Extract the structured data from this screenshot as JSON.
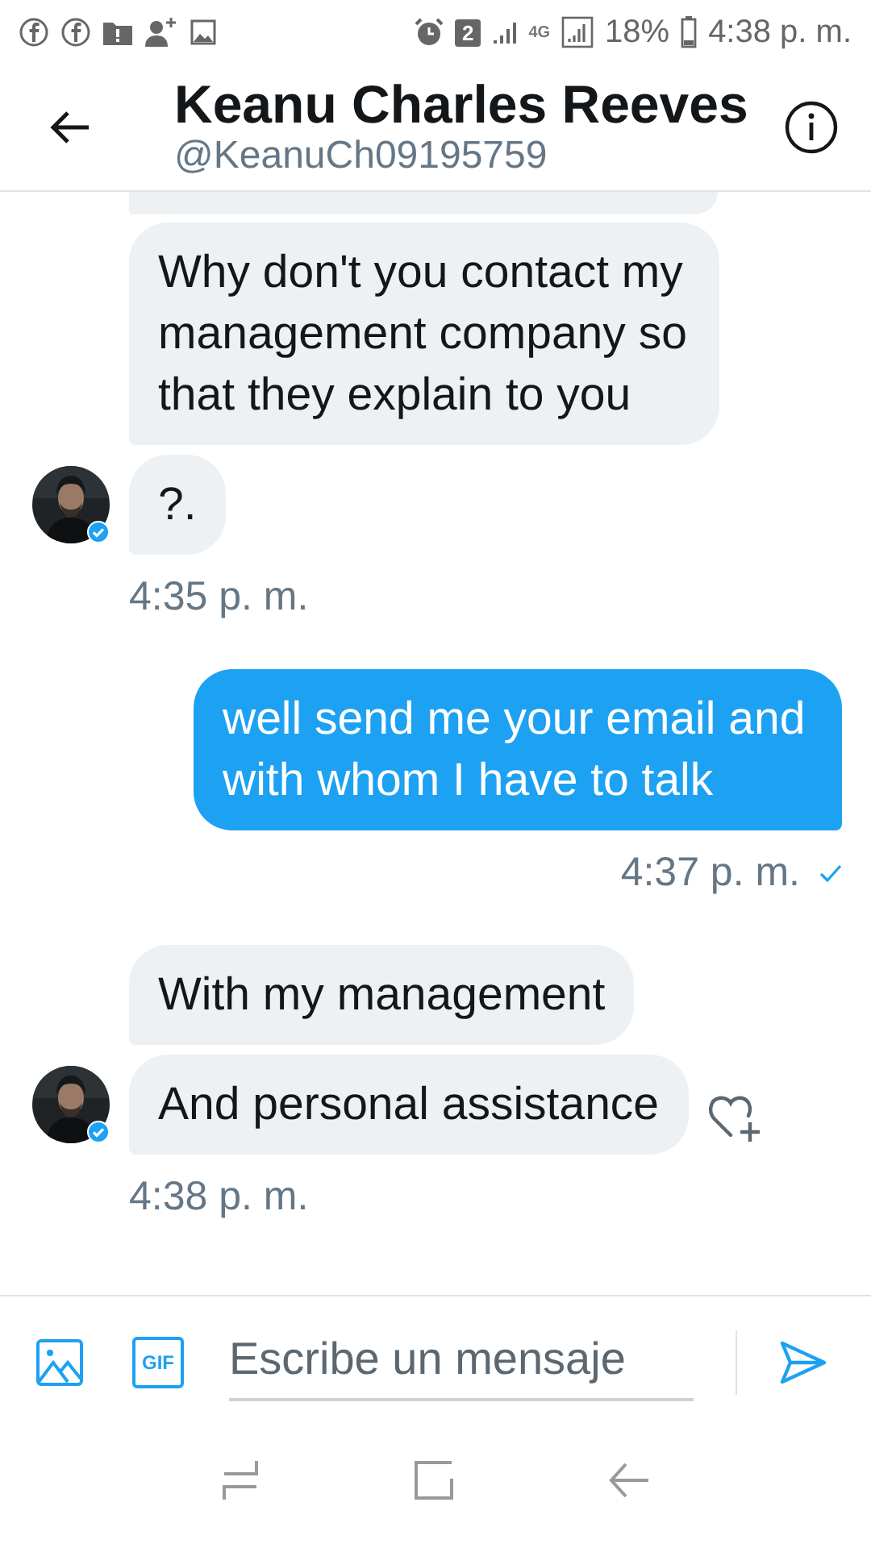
{
  "status_bar": {
    "sim_badge": "2",
    "network": "4G",
    "battery": "18%",
    "time": "4:38 p. m."
  },
  "header": {
    "name": "Keanu Charles Reeves",
    "handle": "@KeanuCh09195759"
  },
  "messages": [
    {
      "kind": "received",
      "bubbles": [
        "Why don't you contact my management company so that they explain to you",
        "?."
      ],
      "time": "4:35 p. m."
    },
    {
      "kind": "sent",
      "bubbles": [
        "well send me your email and with whom I have to talk"
      ],
      "time": "4:37 p. m.",
      "read": true
    },
    {
      "kind": "received",
      "bubbles": [
        "With my management",
        "And personal assistance"
      ],
      "time": "4:38 p. m.",
      "like_button": true
    }
  ],
  "composer": {
    "gif_label": "GIF",
    "placeholder": "Escribe un mensaje"
  }
}
